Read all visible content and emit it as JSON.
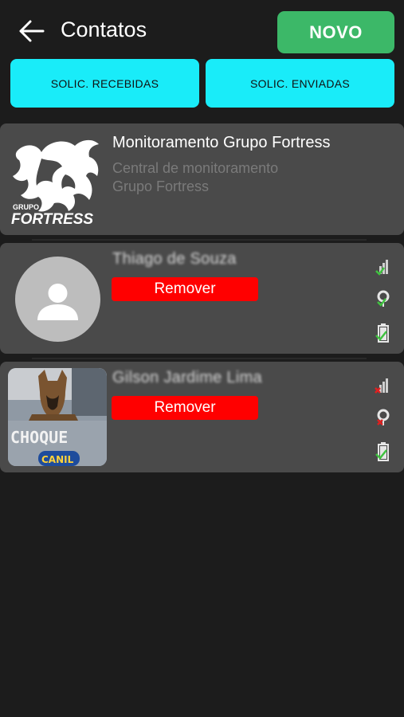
{
  "header": {
    "back_icon": "arrow-left-icon",
    "title": "Contatos",
    "new_button": "NOVO"
  },
  "requests": {
    "received_label": "SOLIC. RECEBIDAS",
    "sent_label": "SOLIC. ENVIADAS"
  },
  "central": {
    "logo_text_top": "GRUPO",
    "logo_text_main": "FORTRESS",
    "name": "Monitoramento Grupo Fortress",
    "description_line1": "Central de monitoramento",
    "description_line2": "Grupo Fortress"
  },
  "contacts": [
    {
      "name": "Thiago de Souza",
      "remove_label": "Remover",
      "avatar": "person-placeholder-icon",
      "signal_status": "ok",
      "location_status": "ok",
      "battery_status": "ok"
    },
    {
      "name": "Gilson Jardime Lima",
      "remove_label": "Remover",
      "avatar": "dog-photo",
      "photo_text_1": "CHOQUE",
      "photo_text_2": "CANIL",
      "signal_status": "error",
      "location_status": "error",
      "battery_status": "ok"
    }
  ],
  "colors": {
    "background": "#1c1c1c",
    "card": "#4a4a4a",
    "accent_green": "#3cb868",
    "accent_cyan": "#19ecf9",
    "danger_red": "#ff0000",
    "status_ok": "#3fc23f",
    "status_error": "#e02020"
  }
}
